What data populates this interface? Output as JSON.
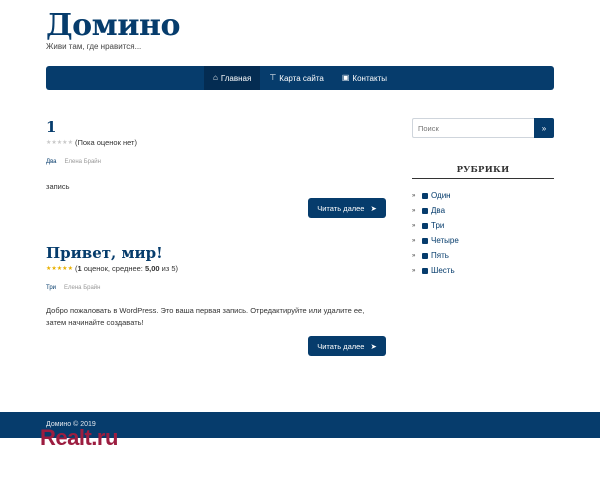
{
  "site": {
    "title": "Домино",
    "tagline": "Живи там, где нравится..."
  },
  "nav": {
    "items": [
      {
        "label": "Главная",
        "icon": "home-icon",
        "active": true
      },
      {
        "label": "Карта сайта",
        "icon": "sitemap-icon",
        "active": false
      },
      {
        "label": "Контакты",
        "icon": "contacts-icon",
        "active": false
      }
    ]
  },
  "posts": [
    {
      "title": "1",
      "rating_text": "(Пока оценок нет)",
      "stars": 0,
      "category": "Два",
      "author": "Елена Брайн",
      "excerpt": "запись",
      "read_more": "Читать далее"
    },
    {
      "title": "Привет, мир!",
      "rating_prefix": "(",
      "rating_count": "1",
      "rating_mid": " оценок, среднее: ",
      "rating_avg": "5,00",
      "rating_suffix": " из 5)",
      "stars": 5,
      "category": "Три",
      "author": "Елена Брайн",
      "excerpt": "Добро пожаловать в WordPress. Это ваша первая запись. Отредактируйте или удалите ее, затем начинайте создавать!",
      "read_more": "Читать далее"
    }
  ],
  "sidebar": {
    "search_placeholder": "Поиск",
    "widget_title": "РУБРИКИ",
    "categories": [
      "Один",
      "Два",
      "Три",
      "Четыре",
      "Пять",
      "Шесть"
    ]
  },
  "footer": {
    "text": "Домино © 2019"
  },
  "watermark": "Realt.ru",
  "colors": {
    "primary": "#063c6c",
    "watermark": "#9c1d40",
    "star": "#e8b000"
  }
}
